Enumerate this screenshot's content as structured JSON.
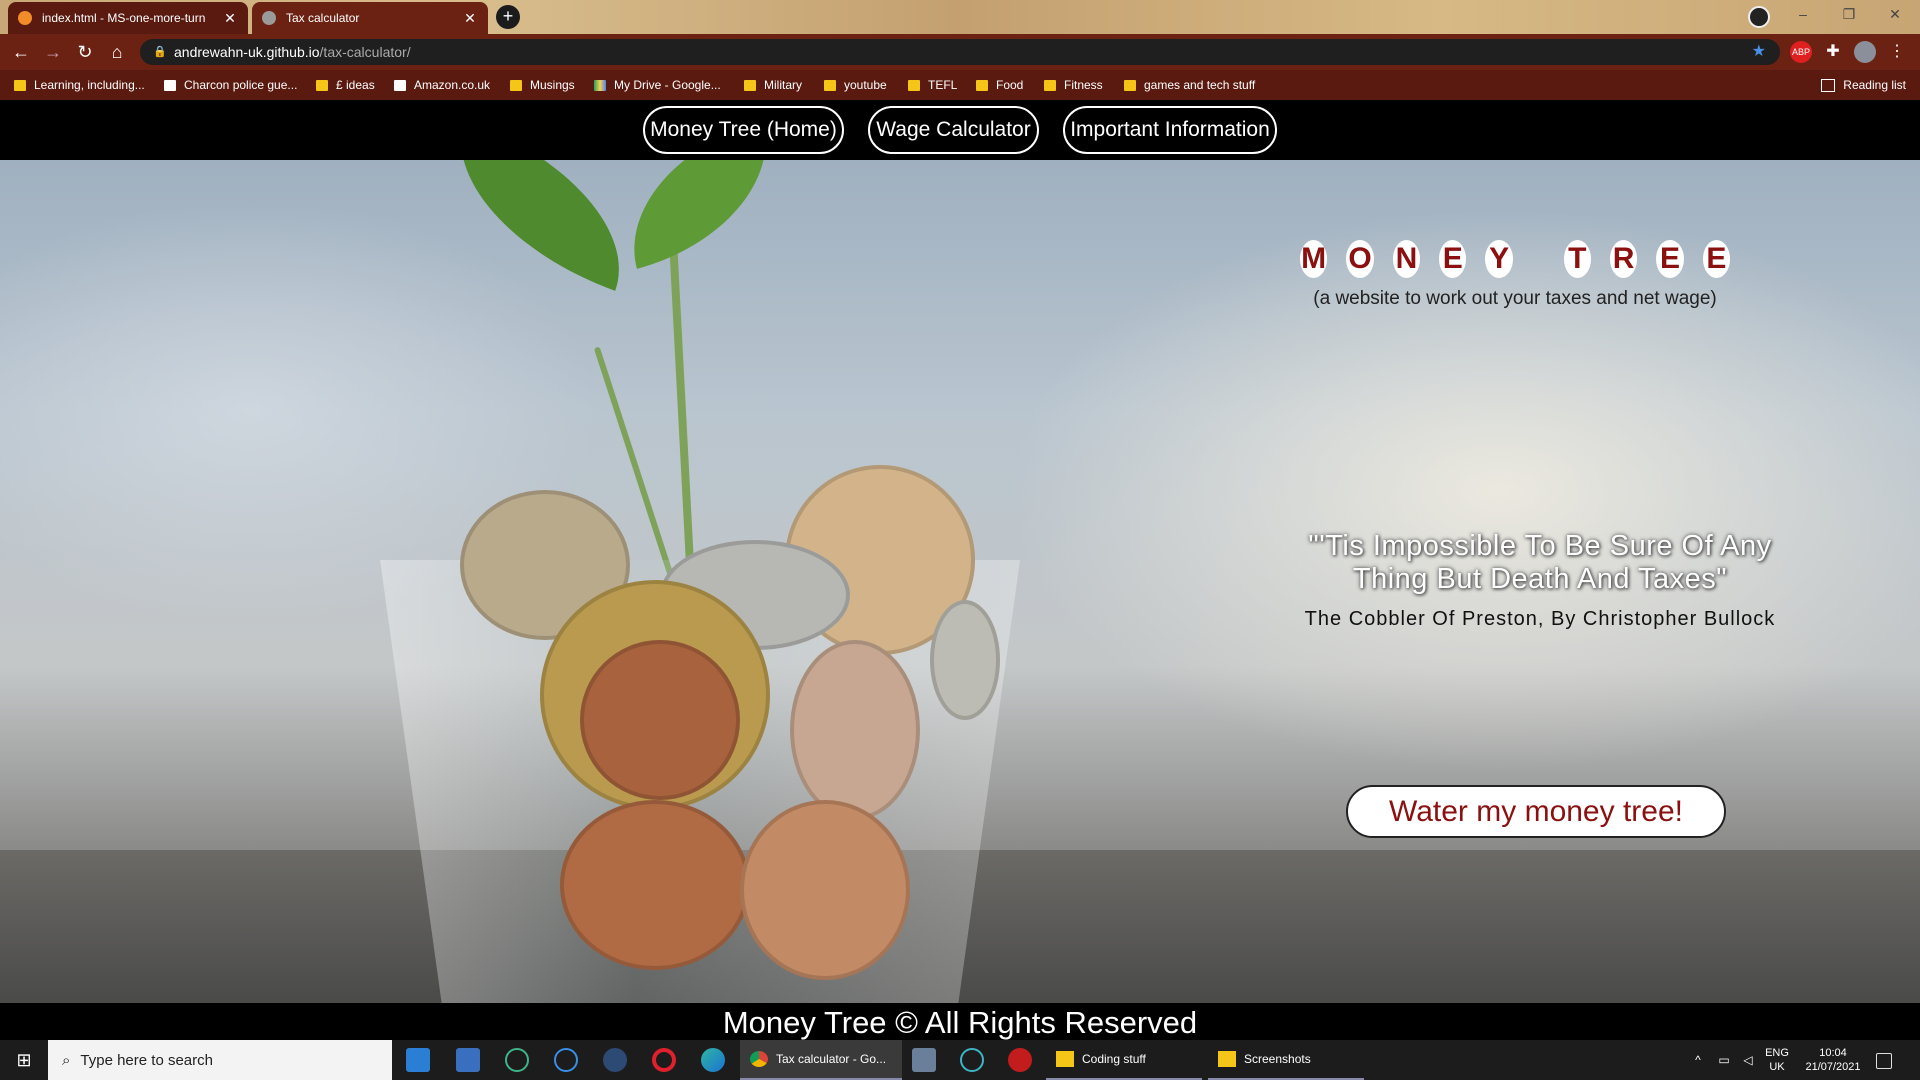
{
  "browser": {
    "tabs": [
      {
        "label": "index.html - MS-one-more-turn",
        "active": false
      },
      {
        "label": "Tax calculator",
        "active": true
      }
    ],
    "new_tab": "+",
    "window_controls": [
      "–",
      "❐",
      "✕"
    ],
    "url_host": "andrewahn-uk.github.io",
    "url_path": "/tax-calculator/",
    "extension_badge": "ABP",
    "bookmarks": [
      "Learning, including...",
      "Charcon police gue...",
      "£ ideas",
      "Amazon.co.uk",
      "Musings",
      "My Drive - Google...",
      "Military",
      "youtube",
      "TEFL",
      "Food",
      "Fitness",
      "games and tech stuff"
    ],
    "reading_list": "Reading list"
  },
  "site": {
    "nav": [
      "Money Tree (Home)",
      "Wage Calculator",
      "Important Information"
    ],
    "brand_letters": [
      "M",
      "O",
      "N",
      "E",
      "Y",
      "",
      "T",
      "R",
      "E",
      "E"
    ],
    "tagline": "(a website to work out your taxes and net wage)",
    "quote": "\"'Tis Impossible To Be Sure Of Any Thing But Death And Taxes\"",
    "quote_source": "The Cobbler Of Preston, By Christopher Bullock",
    "cta": "Water my money tree!",
    "footer": "Money Tree © All Rights Reserved",
    "colors": {
      "brand_red": "#8b1010",
      "nav_bg": "#000000"
    }
  },
  "taskbar": {
    "search_placeholder": "Type here to search",
    "apps": [
      {
        "label": "Tax calculator - Go...",
        "icon": "chrome-icon"
      },
      {
        "label": "Coding stuff",
        "icon": "folder-icon"
      },
      {
        "label": "Screenshots",
        "icon": "folder-icon"
      }
    ],
    "lang_line1": "ENG",
    "lang_line2": "UK",
    "time": "10:04",
    "date": "21/07/2021"
  }
}
